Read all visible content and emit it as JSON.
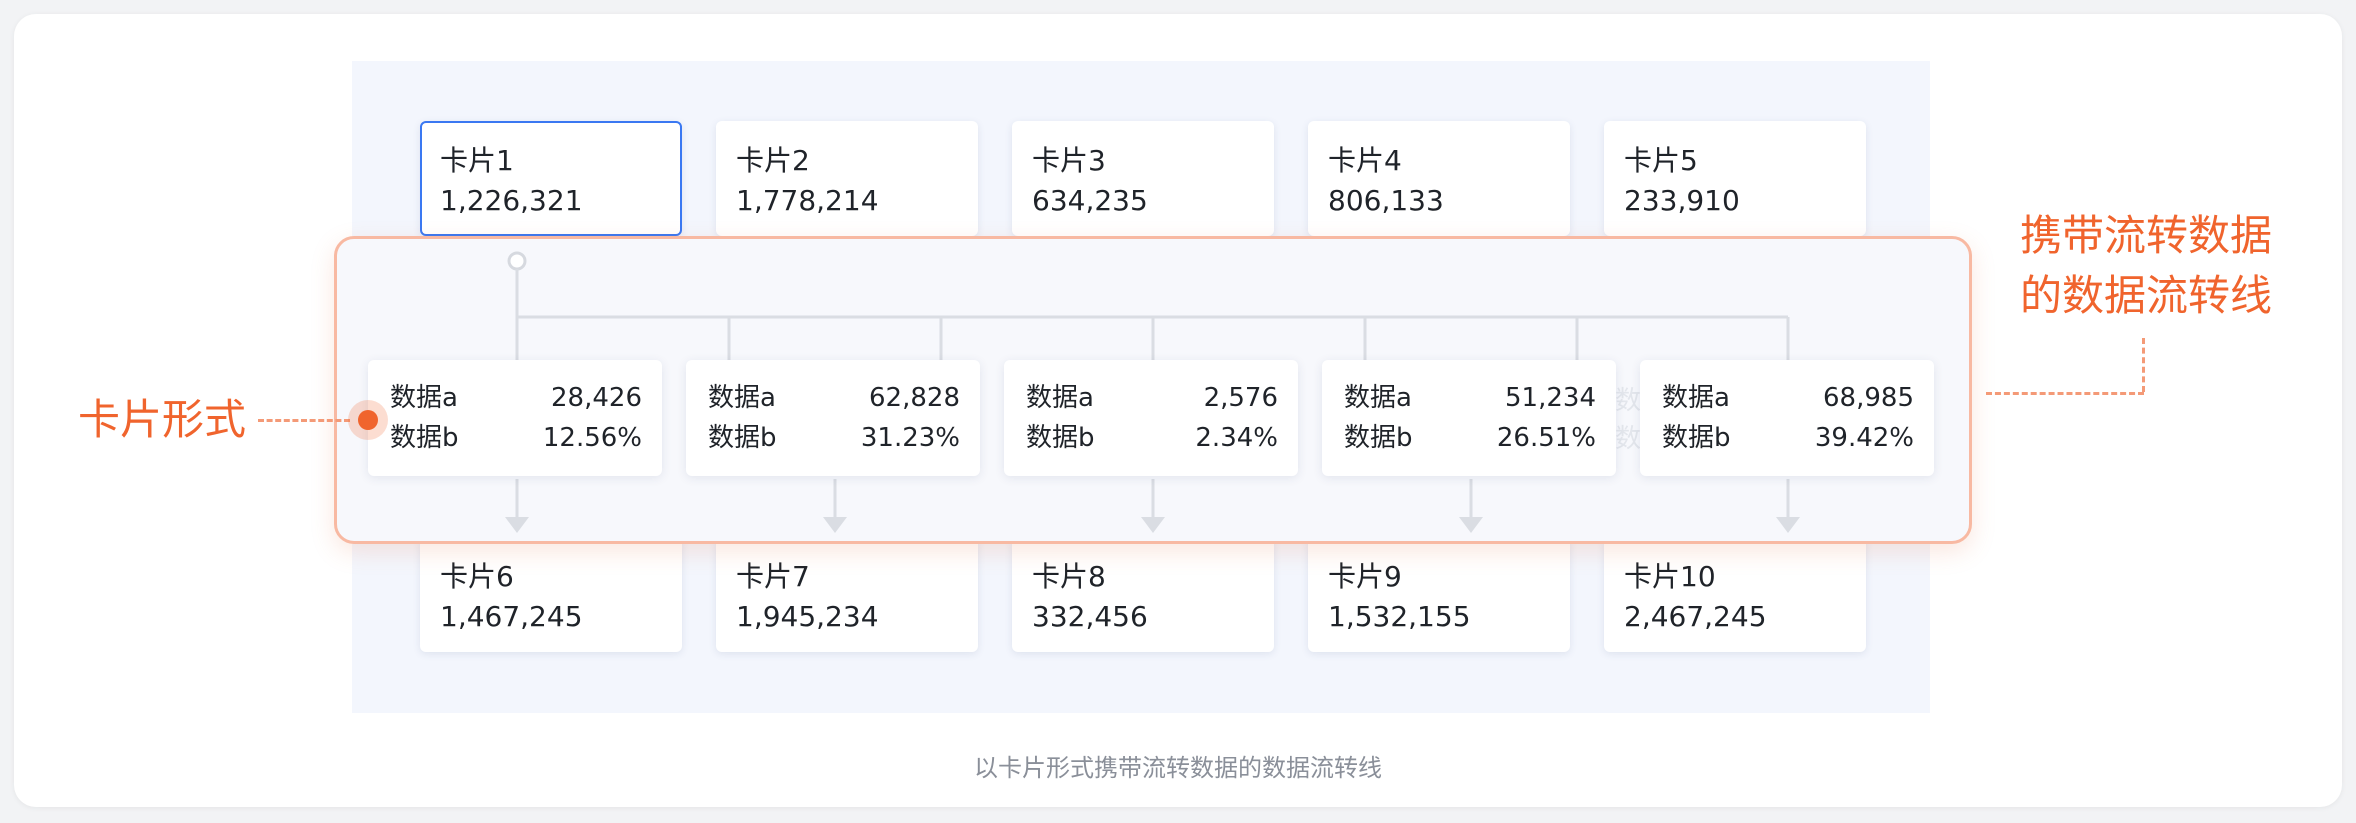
{
  "top_cards": [
    {
      "title": "卡片1",
      "value": "1,226,321"
    },
    {
      "title": "卡片2",
      "value": "1,778,214"
    },
    {
      "title": "卡片3",
      "value": "634,235"
    },
    {
      "title": "卡片4",
      "value": "806,133"
    },
    {
      "title": "卡片5",
      "value": "233,910"
    }
  ],
  "bottom_cards": [
    {
      "title": "卡片6",
      "value": "1,467,245"
    },
    {
      "title": "卡片7",
      "value": "1,945,234"
    },
    {
      "title": "卡片8",
      "value": "332,456"
    },
    {
      "title": "卡片9",
      "value": "1,532,155"
    },
    {
      "title": "卡片10",
      "value": "2,467,245"
    }
  ],
  "data_cards": [
    {
      "label_a": "数据a",
      "value_a": "28,426",
      "label_b": "数据b",
      "value_b": "12.56%"
    },
    {
      "label_a": "数据a",
      "value_a": "62,828",
      "label_b": "数据b",
      "value_b": "31.23%"
    },
    {
      "label_a": "数据a",
      "value_a": "2,576",
      "label_b": "数据b",
      "value_b": "2.34%"
    },
    {
      "label_a": "数据a",
      "value_a": "51,234",
      "label_b": "数据b",
      "value_b": "26.51%"
    },
    {
      "label_a": "数据a",
      "value_a": "68,985",
      "label_b": "数据b",
      "value_b": "39.42%"
    }
  ],
  "annotations": {
    "left_label": "卡片形式",
    "right_label_line1": "携带流转数据",
    "right_label_line2": "的数据流转线"
  },
  "caption": "以卡片形式携带流转数据的数据流转线",
  "colors": {
    "accent": "#f0642d",
    "selected_border": "#3a78f2",
    "flow_line": "#dadde3",
    "panel_border": "#f8b9a2"
  }
}
